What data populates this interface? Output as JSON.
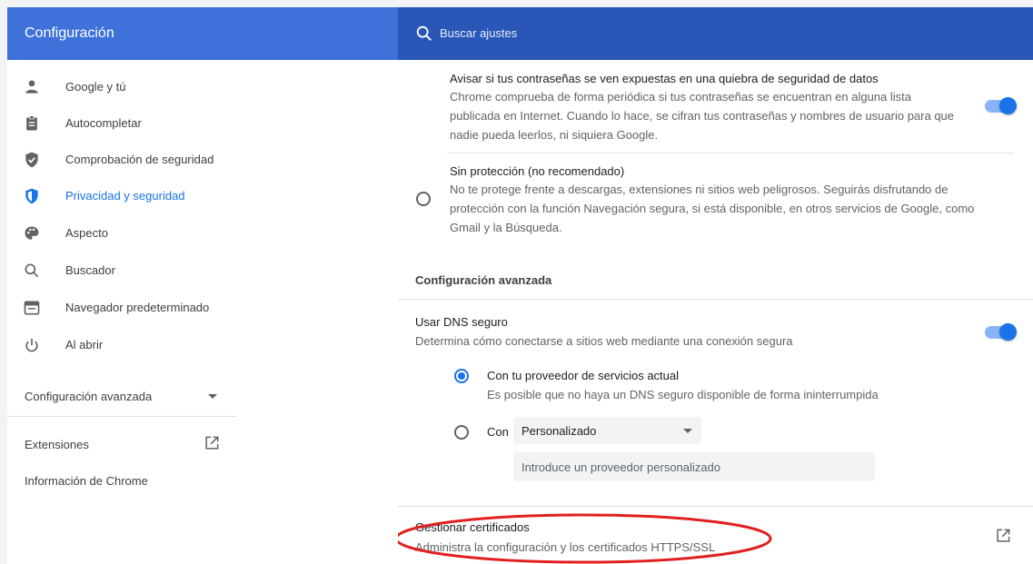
{
  "header": {
    "title": "Configuración",
    "search_placeholder": "Buscar ajustes",
    "colors": {
      "bar": "#3367d6",
      "bar_left": "#3e72da",
      "search": "#2a56b8"
    }
  },
  "sidebar": {
    "items": [
      {
        "label": "Google y tú",
        "icon": "person-icon",
        "selected": false
      },
      {
        "label": "Autocompletar",
        "icon": "clipboard-icon",
        "selected": false
      },
      {
        "label": "Comprobación de seguridad",
        "icon": "shield-check-icon",
        "selected": false
      },
      {
        "label": "Privacidad y seguridad",
        "icon": "shield-privacy-icon",
        "selected": true
      },
      {
        "label": "Aspecto",
        "icon": "palette-icon",
        "selected": false
      },
      {
        "label": "Buscador",
        "icon": "search-icon",
        "selected": false
      },
      {
        "label": "Navegador predeterminado",
        "icon": "browser-window-icon",
        "selected": false
      },
      {
        "label": "Al abrir",
        "icon": "power-icon",
        "selected": false
      }
    ],
    "advanced_label": "Configuración avanzada",
    "extensions_label": "Extensiones",
    "about_label": "Información de Chrome"
  },
  "main": {
    "password_leak": {
      "title": "Avisar si tus contraseñas se ven expuestas en una quiebra de seguridad de datos",
      "desc_lines": [
        "Chrome comprueba de forma periódica si tus contraseñas se encuentran en alguna lista",
        "publicada en Internet. Cuando lo hace, se cifran tus contraseñas y nombres de usuario para que",
        "nadie pueda leerlos, ni siquiera Google."
      ],
      "enabled": true
    },
    "no_protection": {
      "title": "Sin protección (no recomendado)",
      "desc_lines": [
        "No te protege frente a descargas, extensiones ni sitios web peligrosos. Seguirás disfrutando de",
        "protección con la función Navegación segura, si está disponible, en otros servicios de Google, como",
        "Gmail y la Búsqueda."
      ],
      "selected": false
    },
    "advanced_heading": "Configuración avanzada",
    "secure_dns": {
      "title": "Usar DNS seguro",
      "desc": "Determina cómo conectarse a sitios web mediante una conexión segura",
      "enabled": true,
      "option_current": {
        "title": "Con tu proveedor de servicios actual",
        "desc": "Es posible que no haya un DNS seguro disponible de forma ininterrumpida",
        "selected": true
      },
      "option_custom": {
        "label": "Con",
        "select_value": "Personalizado",
        "input_placeholder": "Introduce un proveedor personalizado",
        "selected": false
      }
    },
    "certificates": {
      "title": "Gestionar certificados",
      "desc": "Administra la configuración y los certificados HTTPS/SSL"
    }
  },
  "colors": {
    "accent": "#1a73e8",
    "annotation": "#e0201f"
  }
}
